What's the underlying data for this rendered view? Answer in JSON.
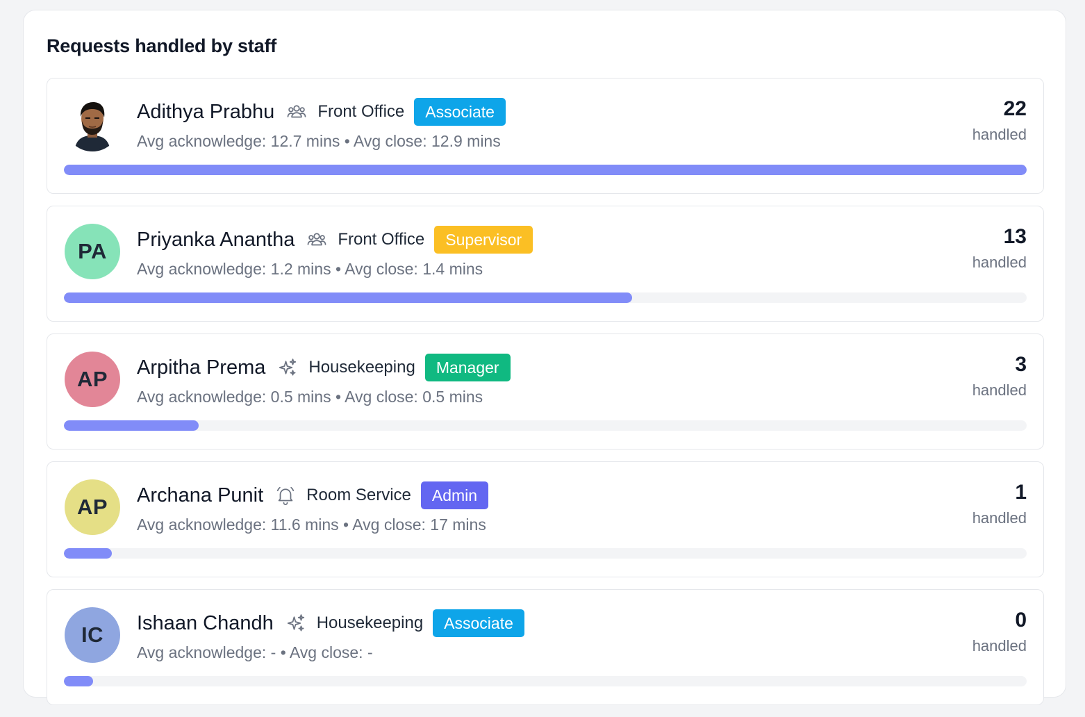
{
  "panel": {
    "title": "Requests handled by staff"
  },
  "staff": [
    {
      "name": "Adithya Prabhu",
      "avatar": {
        "type": "photo",
        "initials": "",
        "color": ""
      },
      "dept_icon": "users-icon",
      "department": "Front Office",
      "role": "Associate",
      "role_color": "#0ea5e9",
      "stats": "Avg acknowledge: 12.7 mins • Avg close: 12.9 mins",
      "count": "22",
      "count_label": "handled",
      "progress": 1.0
    },
    {
      "name": "Priyanka Anantha",
      "avatar": {
        "type": "initials",
        "initials": "PA",
        "color": "#86e3b8"
      },
      "dept_icon": "users-icon",
      "department": "Front Office",
      "role": "Supervisor",
      "role_color": "#fbbf24",
      "stats": "Avg acknowledge: 1.2 mins • Avg close: 1.4 mins",
      "count": "13",
      "count_label": "handled",
      "progress": 0.59
    },
    {
      "name": "Arpitha Prema",
      "avatar": {
        "type": "initials",
        "initials": "AP",
        "color": "#e28697"
      },
      "dept_icon": "sparkles-icon",
      "department": "Housekeeping",
      "role": "Manager",
      "role_color": "#10b981",
      "stats": "Avg acknowledge: 0.5 mins • Avg close: 0.5 mins",
      "count": "3",
      "count_label": "handled",
      "progress": 0.14
    },
    {
      "name": "Archana Punit",
      "avatar": {
        "type": "initials",
        "initials": "AP",
        "color": "#e5df86"
      },
      "dept_icon": "bell-icon",
      "department": "Room Service",
      "role": "Admin",
      "role_color": "#6366f1",
      "stats": "Avg acknowledge: 11.6 mins • Avg close: 17 mins",
      "count": "1",
      "count_label": "handled",
      "progress": 0.05
    },
    {
      "name": "Ishaan Chandh",
      "avatar": {
        "type": "initials",
        "initials": "IC",
        "color": "#8fa6e0"
      },
      "dept_icon": "sparkles-icon",
      "department": "Housekeeping",
      "role": "Associate",
      "role_color": "#0ea5e9",
      "stats": "Avg acknowledge: - • Avg close: -",
      "count": "0",
      "count_label": "handled",
      "progress": 0.03
    }
  ]
}
